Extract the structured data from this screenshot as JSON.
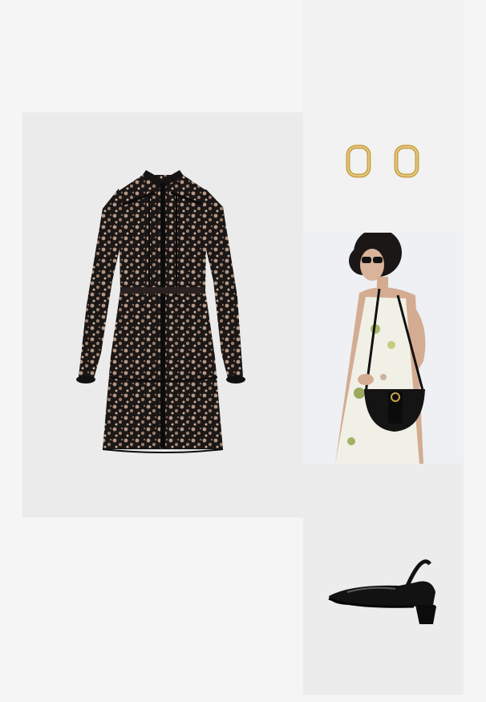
{
  "colors": {
    "page_background": "#f5f5f5",
    "dress_tile": "#ebebeb",
    "earrings_tile": "#f2f2f2",
    "bag_tile": "#eef0f3",
    "shoe_tile": "#ececec",
    "gold": "#c9a44a",
    "black": "#111111"
  },
  "items": [
    {
      "name": "dress",
      "icon": "floral-shirt-dress"
    },
    {
      "name": "earrings",
      "icon": "gold-hoop-earrings"
    },
    {
      "name": "bag",
      "icon": "black-saddle-crossbody-bag"
    },
    {
      "name": "shoe",
      "icon": "black-patent-slingback-heel"
    }
  ]
}
